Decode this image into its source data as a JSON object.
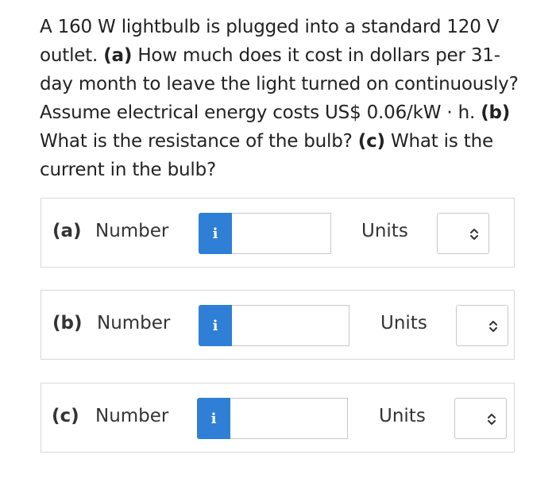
{
  "question": {
    "intro": "A 160 W lightbulb is plugged into a standard 120 V outlet. ",
    "part_a_tag": "(a)",
    "part_a_text": " How much does it cost in dollars per 31-day month to leave the light turned on continuously? Assume electrical energy costs US$ 0.06/kW · h. ",
    "part_b_tag": "(b)",
    "part_b_text": " What is the resistance of the bulb? ",
    "part_c_tag": "(c)",
    "part_c_text": " What is the current in the bulb?"
  },
  "answers": [
    {
      "part": "(a)",
      "number_label": "Number",
      "info_icon": "i",
      "value": "",
      "units_label": "Units",
      "units_value": ""
    },
    {
      "part": "(b)",
      "number_label": "Number",
      "info_icon": "i",
      "value": "",
      "units_label": "Units",
      "units_value": ""
    },
    {
      "part": "(c)",
      "number_label": "Number",
      "info_icon": "i",
      "value": "",
      "units_label": "Units",
      "units_value": ""
    }
  ],
  "colors": {
    "info_button": "#2f7fd6",
    "border": "#d9d9d9"
  },
  "icons": {
    "info": "info-icon",
    "select": "chevron-up-down-icon"
  }
}
